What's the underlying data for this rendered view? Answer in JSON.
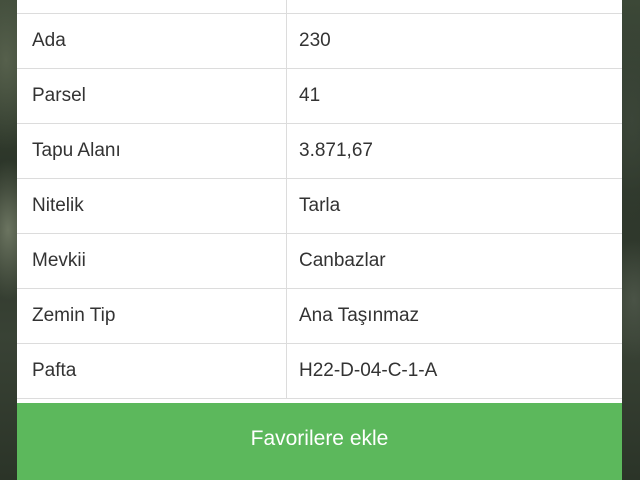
{
  "parcel_info": {
    "rows": [
      {
        "label": "Ada",
        "value": "230"
      },
      {
        "label": "Parsel",
        "value": "41"
      },
      {
        "label": "Tapu Alanı",
        "value": "3.871,67"
      },
      {
        "label": "Nitelik",
        "value": "Tarla"
      },
      {
        "label": "Mevkii",
        "value": "Canbazlar"
      },
      {
        "label": "Zemin Tip",
        "value": "Ana Taşınmaz"
      },
      {
        "label": "Pafta",
        "value": "H22-D-04-C-1-A"
      }
    ]
  },
  "actions": {
    "favorite_label": "Favorilere ekle",
    "button_color": "#5cb85c"
  }
}
